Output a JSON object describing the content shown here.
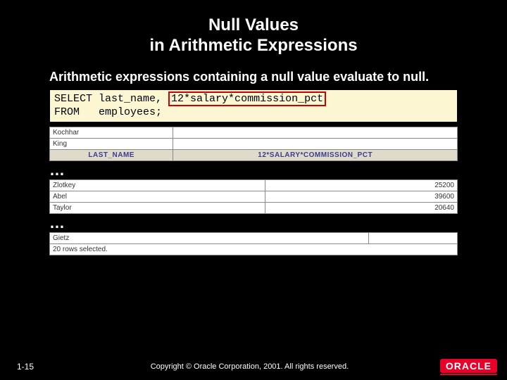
{
  "title": {
    "line1": "Null Values",
    "line2": "in Arithmetic Expressions"
  },
  "subtitle": "Arithmetic expressions containing a null value evaluate to null.",
  "sql": {
    "kw_select": "SELECT",
    "cols_before": " last_name, ",
    "highlighted": "12*salary*commission_pct",
    "kw_from": "FROM",
    "table": "   employees;"
  },
  "result": {
    "headers": [
      "LAST_NAME",
      "12*SALARY*COMMISSION_PCT"
    ],
    "top_rows": [
      {
        "name": "Kochhar",
        "val": ""
      },
      {
        "name": "King",
        "val": ""
      }
    ],
    "mid_rows": [
      {
        "name": "Zlotkey",
        "val": "25200"
      },
      {
        "name": "Abel",
        "val": "39600"
      },
      {
        "name": "Taylor",
        "val": "20640"
      }
    ],
    "bottom_rows": [
      {
        "name": "Gietz",
        "val": ""
      }
    ],
    "rowcount": "20 rows selected."
  },
  "ellipsis": "…",
  "footer": {
    "slide": "1-15",
    "copyright": "Copyright © Oracle Corporation, 2001. All rights reserved.",
    "logo": "ORACLE"
  }
}
